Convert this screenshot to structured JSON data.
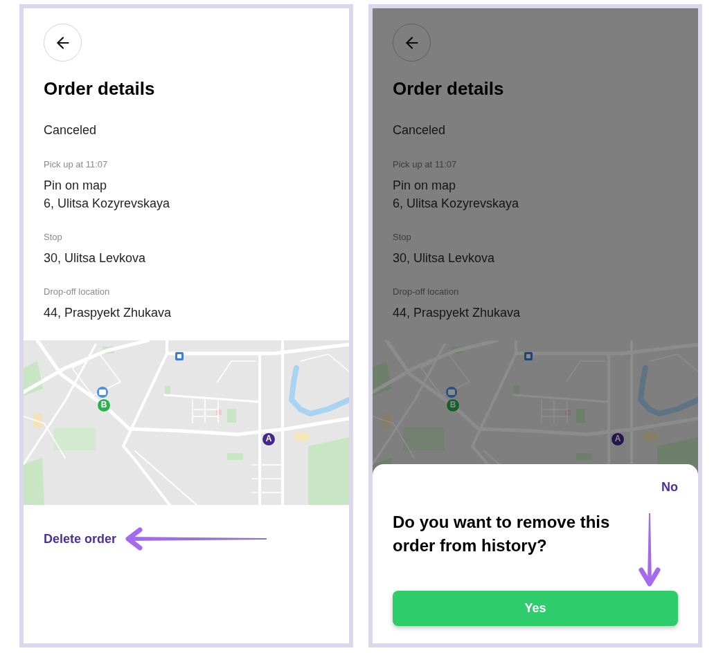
{
  "screens": [
    {
      "dimmed": false,
      "title": "Order details",
      "status": "Canceled",
      "stops": [
        {
          "label": "Pick up at 11:07",
          "lines": [
            "Pin on map",
            "6, Ulitsa Kozyrevskaya"
          ]
        },
        {
          "label": "Stop",
          "lines": [
            "30, Ulitsa Levkova"
          ]
        },
        {
          "label": "Drop-off location",
          "lines": [
            "44, Praspyekt Zhukava"
          ]
        }
      ],
      "map": {
        "markers": [
          {
            "label": "B",
            "color": "#27b24a"
          },
          {
            "label": "A",
            "color": "#45288e"
          }
        ]
      },
      "delete_link": {
        "label": "Delete order",
        "highlighted": true
      }
    },
    {
      "dimmed": true,
      "title": "Order details",
      "status": "Canceled",
      "stops": [
        {
          "label": "Pick up at 11:07",
          "lines": [
            "Pin on map",
            "6, Ulitsa Kozyrevskaya"
          ]
        },
        {
          "label": "Stop",
          "lines": [
            "30, Ulitsa Levkova"
          ]
        },
        {
          "label": "Drop-off location",
          "lines": [
            "44, Praspyekt Zhukava"
          ]
        }
      ],
      "map": {
        "markers": [
          {
            "label": "B",
            "color": "#156229"
          },
          {
            "label": "A",
            "color": "#26164e"
          }
        ]
      },
      "dialog": {
        "close_label": "No",
        "question": "Do you want to remove this order from history?",
        "confirm": {
          "label": "Yes",
          "highlighted": true
        }
      }
    }
  ]
}
